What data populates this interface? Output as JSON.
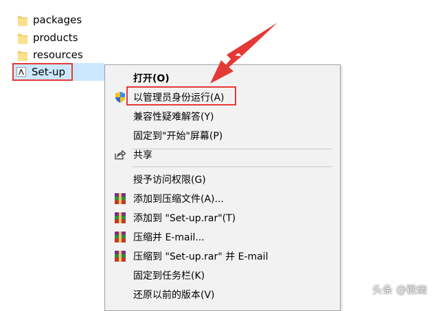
{
  "explorer": {
    "items": [
      {
        "label": "packages",
        "icon": "folder-icon"
      },
      {
        "label": "products",
        "icon": "folder-icon"
      },
      {
        "label": "resources",
        "icon": "folder-icon"
      }
    ],
    "selected_file": {
      "label": "Set-up",
      "icon": "adobe-app-icon"
    }
  },
  "context_menu": {
    "items": [
      {
        "label": "打开(O)",
        "icon": "",
        "bold": true
      },
      {
        "label": "以管理员身份运行(A)",
        "icon": "uac-shield-icon"
      },
      {
        "label": "兼容性疑难解答(Y)",
        "icon": ""
      },
      {
        "label": "固定到\"开始\"屏幕(P)",
        "icon": ""
      },
      {
        "label": "共享",
        "icon": "share-icon"
      },
      {
        "label": "授予访问权限(G)",
        "icon": ""
      },
      {
        "label": "添加到压缩文件(A)...",
        "icon": "winrar-icon"
      },
      {
        "label": "添加到 \"Set-up.rar\"(T)",
        "icon": "winrar-icon"
      },
      {
        "label": "压缩并 E-mail...",
        "icon": "winrar-icon"
      },
      {
        "label": "压缩到 \"Set-up.rar\" 并 E-mail",
        "icon": "winrar-icon"
      },
      {
        "label": "固定到任务栏(K)",
        "icon": ""
      },
      {
        "label": "还原以前的版本(V)",
        "icon": ""
      }
    ]
  },
  "watermark": "头条 @微幽",
  "colors": {
    "selection": "#cce8ff",
    "highlight_red": "#e53935",
    "menu_bg": "#f2f2f2",
    "folder_yellow": "#f8d775"
  }
}
